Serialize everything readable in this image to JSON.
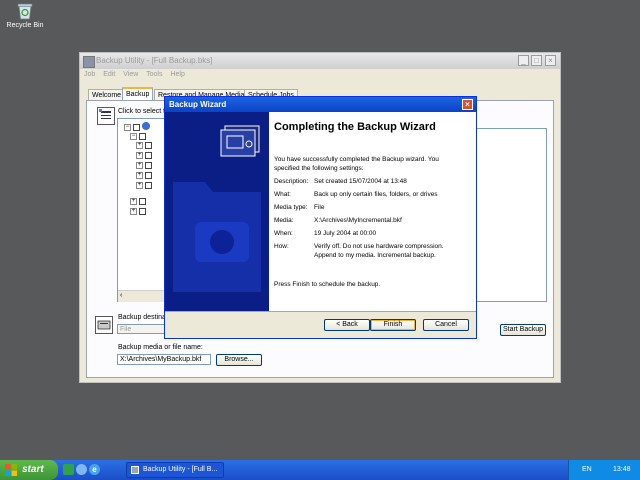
{
  "desktop": {
    "recycle_bin_label": "Recycle Bin"
  },
  "main_window": {
    "title": "Backup Utility - [Full Backup.bks]",
    "menu": [
      "Job",
      "Edit",
      "View",
      "Tools",
      "Help"
    ],
    "tabs": [
      "Welcome",
      "Backup",
      "Restore and Manage Media",
      "Schedule Jobs"
    ],
    "active_tab": "Backup",
    "select_label": "Click to select t",
    "backup_destination_label": "Backup destina",
    "backup_destination_value": "File",
    "media_name_label": "Backup media or file name:",
    "media_name_value": "X:\\Archives\\MyBackup.bkf",
    "browse_button": "Browse...",
    "start_backup_button": "Start Backup"
  },
  "wizard": {
    "title": "Backup Wizard",
    "heading": "Completing the Backup Wizard",
    "intro": "You have successfully completed the Backup wizard. You specified the following settings:",
    "settings": [
      {
        "label": "Description:",
        "value": "Set created 15/07/2004 at 13:48"
      },
      {
        "label": "What:",
        "value": "Back up only certain files, folders, or drives"
      },
      {
        "label": "Media type:",
        "value": "File"
      },
      {
        "label": "Media:",
        "value": "X:\\Archives\\MyIncremental.bkf"
      },
      {
        "label": "When:",
        "value": "19 July 2004 at 00:00"
      },
      {
        "label": "How:",
        "value": "Verify off. Do not use hardware compression. Append to my media. Incremental backup."
      }
    ],
    "footer_text": "Press Finish to schedule the backup.",
    "buttons": {
      "back": "< Back",
      "finish": "Finish",
      "cancel": "Cancel"
    }
  },
  "taskbar": {
    "start_label": "start",
    "task_item": "Backup Utility - [Full B...",
    "language": "EN",
    "clock": "13:48"
  },
  "colors": {
    "accent": "#0a43c7",
    "wizard_panel": "#0a1e86",
    "desktop": "#58595b"
  }
}
